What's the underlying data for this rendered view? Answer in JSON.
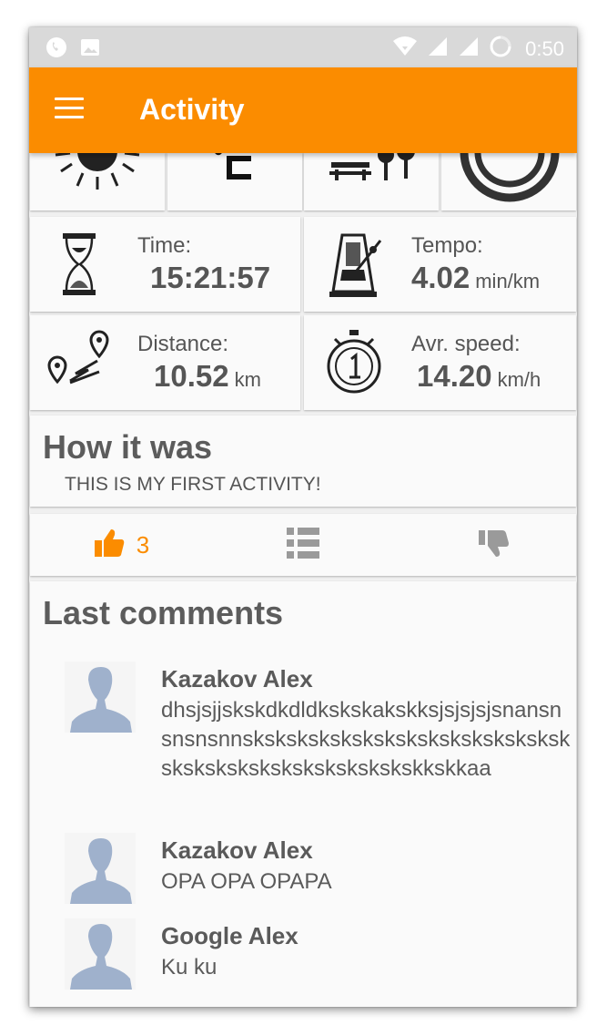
{
  "status_bar": {
    "time": "0:50"
  },
  "app_bar": {
    "title": "Activity"
  },
  "weather_icons": [
    "sun-icon",
    "celsius-icon",
    "picnic-icon",
    "circle-icon"
  ],
  "stats": {
    "time": {
      "label": "Time:",
      "value": "15:21:57",
      "unit": ""
    },
    "tempo": {
      "label": "Tempo:",
      "value": "4.02",
      "unit": "min/km"
    },
    "distance": {
      "label": "Distance:",
      "value": "10.52",
      "unit": "km"
    },
    "avr_speed": {
      "label": "Avr. speed:",
      "value": "14.20",
      "unit": "km/h"
    }
  },
  "how_it_was": {
    "title": "How it was",
    "text": "THIS IS MY FIRST ACTIVITY!"
  },
  "actions": {
    "like_count": "3"
  },
  "comments_section": {
    "title": "Last comments",
    "comments": [
      {
        "author": "Kazakov Alex",
        "text": "dhsjsjjskskdkdldkskskakskksjsjsjsjsnansnsnsnsnnskskskskskskskskskskskskskskskskskskskskskskskskskskskkskkaa"
      },
      {
        "author": "Kazakov Alex",
        "text": "OPA OPA OPAPA"
      },
      {
        "author": "Google Alex",
        "text": "Ku ku"
      }
    ]
  },
  "colors": {
    "accent": "#fb8c00",
    "avatar": "#9fb1cc",
    "status_bar": "#d9d9d9"
  }
}
